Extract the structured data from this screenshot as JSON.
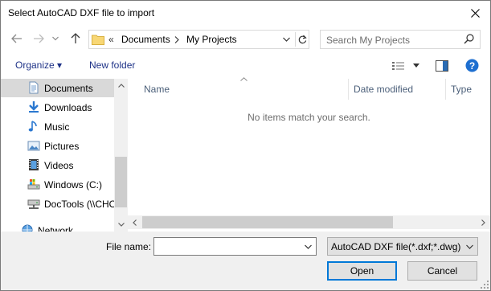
{
  "window": {
    "title": "Select AutoCAD DXF file to import"
  },
  "nav": {
    "back_icon": "arrow-left-icon",
    "forward_icon": "arrow-right-icon",
    "recent_icon": "chevron-down-icon",
    "up_icon": "arrow-up-icon",
    "address": {
      "overflow": "«",
      "crumbs": [
        "Documents",
        "My Projects"
      ]
    },
    "search_placeholder": "Search My Projects"
  },
  "toolbar": {
    "organize": "Organize ▾",
    "new_folder": "New folder"
  },
  "sidebar": {
    "items": [
      {
        "label": "Documents",
        "icon": "documents-icon",
        "selected": true
      },
      {
        "label": "Downloads",
        "icon": "downloads-icon"
      },
      {
        "label": "Music",
        "icon": "music-icon"
      },
      {
        "label": "Pictures",
        "icon": "pictures-icon"
      },
      {
        "label": "Videos",
        "icon": "videos-icon"
      },
      {
        "label": "Windows (C:)",
        "icon": "drive-icon"
      },
      {
        "label": "DocTools (\\\\CHO",
        "icon": "network-drive-icon"
      },
      {
        "label": "Network",
        "icon": "network-icon"
      }
    ]
  },
  "filelist": {
    "columns": [
      "Name",
      "Date modified",
      "Type"
    ],
    "empty_message": "No items match your search."
  },
  "footer": {
    "filename_label": "File name:",
    "filename_value": "",
    "filetype": "AutoCAD DXF file(*.dxf;*.dwg)",
    "open_label": "Open",
    "cancel_label": "Cancel"
  },
  "colors": {
    "accent": "#0078d7",
    "link": "#1e3287",
    "selection": "#d9d9d9",
    "help": "#1e6fd0",
    "folder": "#f8d775"
  }
}
